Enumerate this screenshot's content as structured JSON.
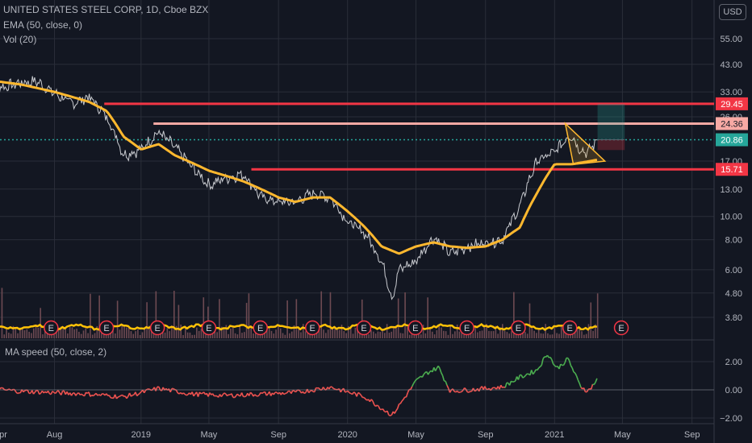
{
  "legend": {
    "symbol_line": "UNITED STATES STEEL CORP, 1D, Cboe BZX",
    "ema_line": "EMA (50, close, 0)",
    "vol_line": "Vol (20)",
    "ma_speed_line": "MA speed (50, close, 2)"
  },
  "currency_button": "USD",
  "price_axis": {
    "scale": "log",
    "ticks": [
      "55.00",
      "43.00",
      "33.00",
      "26.00",
      "17.00",
      "13.00",
      "10.00",
      "8.00",
      "6.00",
      "4.80",
      "3.80"
    ],
    "tick_values": [
      55,
      43,
      33,
      26,
      17,
      13,
      10,
      8,
      6,
      4.8,
      3.8
    ]
  },
  "osc_axis": {
    "ticks": [
      "2.00",
      "0.00",
      "−2.00"
    ],
    "tick_values": [
      2,
      0,
      -2
    ]
  },
  "time_axis": {
    "labels": [
      "pr",
      "Aug",
      "2019",
      "May",
      "Sep",
      "2020",
      "May",
      "Sep",
      "2021",
      "May",
      "Sep"
    ]
  },
  "price_badges": [
    {
      "label": "29.45",
      "value": 29.45,
      "color": "#f23645",
      "text_color": "#ffffff"
    },
    {
      "label": "24.36",
      "value": 24.36,
      "color": "#f7a9a4",
      "text_color": "#131722"
    },
    {
      "label": "20.86",
      "value": 20.86,
      "color": "#26a69a",
      "text_color": "#ffffff"
    },
    {
      "label": "15.71",
      "value": 15.71,
      "color": "#f23645",
      "text_color": "#ffffff"
    }
  ],
  "horizontal_lines": [
    {
      "value": 29.45,
      "color": "#f23645",
      "from_date": "2018-10-28"
    },
    {
      "value": 24.36,
      "color": "#f7a9a4",
      "from_date": "2019-01-23"
    },
    {
      "value": 15.71,
      "color": "#f23645",
      "from_date": "2019-07-15"
    }
  ],
  "earnings_marker": {
    "letter": "E",
    "color": "#f23645"
  },
  "earnings_dates": [
    "2018-07-26",
    "2018-11-01",
    "2019-01-30",
    "2019-05-01",
    "2019-07-31",
    "2019-10-31",
    "2020-01-30",
    "2020-04-30",
    "2020-07-30",
    "2020-10-29",
    "2021-01-28",
    "2021-04-29"
  ],
  "colors": {
    "background": "#131722",
    "grid": "#2a2e39",
    "price_line": "#c8cacf",
    "ema": "#ffb82e",
    "volume": "#6d4a52",
    "volume_avg": "#ffc107",
    "osc_up": "#4caf50",
    "osc_down": "#ef5350",
    "current_price_line": "#26a69a",
    "triangle": "#ffb82e"
  },
  "chart_data": {
    "type": "line",
    "title": "UNITED STATES STEEL CORP, 1D, Cboe BZX",
    "y_scale": "log",
    "ylim": [
      3.3,
      70
    ],
    "x_range": [
      "2018-04-01",
      "2021-09-30"
    ],
    "price_series": {
      "name": "UNITED STATES STEEL CORP",
      "x": [
        "2018-04-01",
        "2018-05-01",
        "2018-06-01",
        "2018-07-01",
        "2018-08-01",
        "2018-09-01",
        "2018-10-01",
        "2018-11-01",
        "2018-12-01",
        "2019-01-01",
        "2019-02-01",
        "2019-03-01",
        "2019-04-01",
        "2019-05-01",
        "2019-06-01",
        "2019-07-01",
        "2019-08-01",
        "2019-09-01",
        "2019-10-01",
        "2019-11-01",
        "2019-12-01",
        "2020-01-01",
        "2020-02-01",
        "2020-03-01",
        "2020-03-20",
        "2020-04-01",
        "2020-05-01",
        "2020-06-01",
        "2020-07-01",
        "2020-08-01",
        "2020-09-01",
        "2020-10-01",
        "2020-11-01",
        "2020-12-01",
        "2021-01-01",
        "2021-01-29",
        "2021-02-15",
        "2021-03-01",
        "2021-03-17"
      ],
      "y": [
        36.5,
        34.5,
        36.0,
        36.5,
        32.5,
        29.5,
        31.5,
        26.0,
        18.0,
        19.0,
        22.5,
        19.5,
        16.0,
        13.5,
        14.5,
        15.0,
        12.0,
        11.5,
        11.5,
        12.5,
        12.0,
        9.5,
        8.5,
        6.5,
        4.5,
        6.0,
        6.5,
        8.2,
        7.0,
        7.5,
        7.8,
        8.0,
        11.0,
        17.0,
        18.5,
        22.0,
        19.0,
        18.5,
        20.86
      ]
    },
    "ema_series": {
      "name": "EMA (50, close, 0)",
      "x": [
        "2018-04-01",
        "2018-06-01",
        "2018-08-01",
        "2018-10-01",
        "2018-11-01",
        "2018-12-01",
        "2019-01-01",
        "2019-02-01",
        "2019-03-01",
        "2019-05-01",
        "2019-07-01",
        "2019-08-01",
        "2019-09-01",
        "2019-10-01",
        "2019-11-01",
        "2019-12-01",
        "2020-01-01",
        "2020-02-01",
        "2020-03-01",
        "2020-04-01",
        "2020-05-01",
        "2020-06-01",
        "2020-07-01",
        "2020-08-01",
        "2020-09-01",
        "2020-10-01",
        "2020-11-01",
        "2020-12-01",
        "2021-01-01",
        "2021-02-01",
        "2021-03-17"
      ],
      "y": [
        37.0,
        35.5,
        33.0,
        30.0,
        27.5,
        21.5,
        19.0,
        20.0,
        18.0,
        15.5,
        14.0,
        13.0,
        12.0,
        11.5,
        12.0,
        12.0,
        10.5,
        9.0,
        7.5,
        7.0,
        7.5,
        7.8,
        7.5,
        7.4,
        7.5,
        8.0,
        9.0,
        12.5,
        16.5,
        16.5,
        17.2
      ]
    },
    "ma_speed_series": {
      "name": "MA speed (50, close, 2)",
      "x": [
        "2018-04-01",
        "2018-06-01",
        "2018-08-01",
        "2018-10-01",
        "2018-12-01",
        "2019-02-01",
        "2019-04-01",
        "2019-06-01",
        "2019-08-01",
        "2019-10-01",
        "2019-12-01",
        "2020-02-01",
        "2020-03-20",
        "2020-05-01",
        "2020-05-20",
        "2020-06-10",
        "2020-07-01",
        "2020-08-01",
        "2020-09-01",
        "2020-10-01",
        "2020-11-01",
        "2020-12-01",
        "2020-12-20",
        "2021-01-05",
        "2021-01-25",
        "2021-02-15",
        "2021-03-01",
        "2021-03-17"
      ],
      "y": [
        0.1,
        -0.1,
        -0.2,
        -0.3,
        -0.5,
        0.1,
        -0.3,
        -0.4,
        -0.3,
        -0.2,
        0.2,
        -0.5,
        -1.8,
        0.6,
        1.2,
        1.6,
        -0.1,
        0.0,
        0.1,
        0.2,
        0.9,
        1.4,
        2.6,
        1.5,
        2.2,
        0.3,
        -0.1,
        0.7
      ]
    },
    "triangle_pattern": {
      "apex_date": "2021-03-31",
      "top_value": 24.36,
      "bottom_value": 15.71,
      "start_date": "2021-01-20"
    },
    "position_box": {
      "entry": 20.86,
      "target": 29.45,
      "stop": 18.9,
      "from_date": "2021-03-18",
      "to_date": "2021-05-05"
    }
  }
}
